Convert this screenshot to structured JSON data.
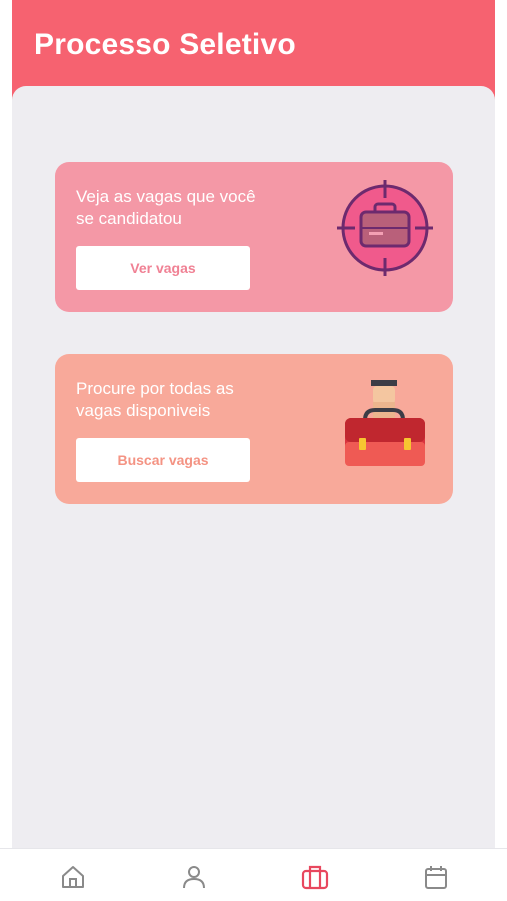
{
  "header": {
    "title": "Processo Seletivo"
  },
  "cards": [
    {
      "text": "Veja as vagas que você se candidatou",
      "button_label": "Ver vagas",
      "icon": "target-briefcase-icon"
    },
    {
      "text": "Procure por todas as vagas disponiveis",
      "button_label": "Buscar vagas",
      "icon": "hand-holding-bag-icon"
    }
  ],
  "bottom_nav": {
    "items": [
      {
        "icon": "home-icon",
        "active": false
      },
      {
        "icon": "user-icon",
        "active": false
      },
      {
        "icon": "briefcase-icon",
        "active": true
      },
      {
        "icon": "calendar-icon",
        "active": false
      }
    ]
  },
  "colors": {
    "header": "#f66270",
    "background": "#eeedf1",
    "card_1": "#f498a6",
    "card_2": "#f8a99a",
    "nav_active": "#e8475e",
    "nav_inactive": "#8a8a8a"
  }
}
